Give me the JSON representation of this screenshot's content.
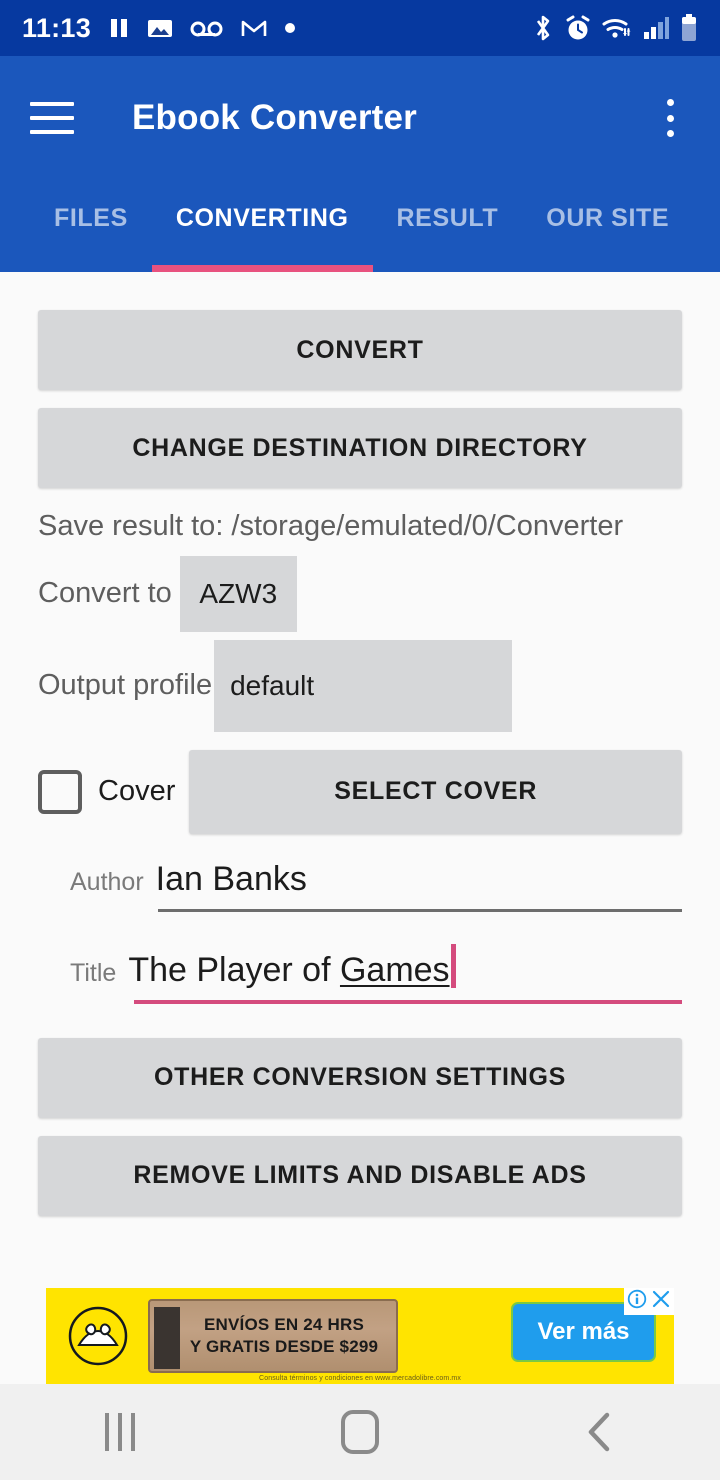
{
  "status_bar": {
    "time": "11:13",
    "left_icons": [
      "pause-icon",
      "photo-icon",
      "voicemail-icon",
      "gmail-icon",
      "dot-icon"
    ],
    "right_icons": [
      "bluetooth-icon",
      "alarm-icon",
      "wifi-icon",
      "signal-icon",
      "battery-icon"
    ],
    "background": "#0639A0"
  },
  "app_bar": {
    "title": "Ebook Converter",
    "menu_icon": "hamburger-icon",
    "overflow_icon": "more-vert-icon",
    "background": "#1B57BC"
  },
  "tabs": {
    "items": [
      {
        "label": "FILES",
        "active": false
      },
      {
        "label": "CONVERTING",
        "active": true
      },
      {
        "label": "RESULT",
        "active": false
      },
      {
        "label": "OUR SITE",
        "active": false
      }
    ],
    "indicator_color": "#E8527F"
  },
  "main": {
    "convert_button": "CONVERT",
    "change_dir_button": "CHANGE DESTINATION DIRECTORY",
    "save_path_text": "Save result to: /storage/emulated/0/Converter",
    "convert_to_label": "Convert to",
    "convert_to_value": "AZW3",
    "output_profile_label": "Output profile",
    "output_profile_value": "default",
    "cover_label": "Cover",
    "cover_checked": false,
    "select_cover_button": "SELECT COVER",
    "author_label": "Author",
    "author_value": "Ian Banks",
    "title_label": "Title",
    "title_value": "The Player of Games",
    "title_focused": true,
    "other_settings_button": "OTHER CONVERSION SETTINGS",
    "remove_limits_button": "REMOVE LIMITS AND DISABLE ADS",
    "button_color": "#D6D7D9",
    "focus_color": "#D44B7D"
  },
  "ad": {
    "headline_line1": "ENVÍOS EN 24 HRS",
    "headline_line2": "Y GRATIS DESDE $299",
    "cta_label": "Ver más",
    "fine_print": "Consulta términos y condiciones en www.mercadolibre.com.mx",
    "info_icon": "adchoices-info-icon",
    "close_icon": "close-icon",
    "background": "#FFE400",
    "cta_color": "#1F9DED"
  },
  "nav_bar": {
    "recents_icon": "recents-icon",
    "home_icon": "home-icon",
    "back_icon": "back-icon"
  }
}
